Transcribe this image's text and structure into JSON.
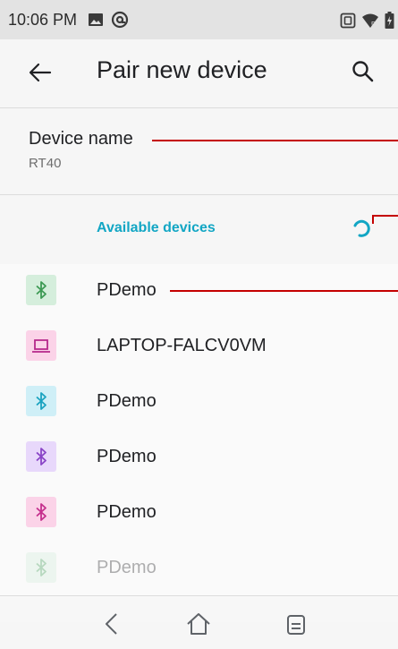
{
  "status_bar": {
    "time": "10:06 PM",
    "left_icons": [
      "image-icon",
      "at-sign-icon"
    ],
    "right_icons": [
      "nfc-icon",
      "wifi-icon",
      "battery-charging-icon"
    ]
  },
  "app_bar": {
    "back_icon": "arrow-left-icon",
    "title": "Pair new device",
    "search_icon": "search-icon"
  },
  "device_name": {
    "label": "Device name",
    "value": "RT40"
  },
  "available_devices": {
    "header": "Available devices",
    "spinner_icon": "loading-spinner-icon",
    "accent_color": "#12a6c4",
    "items": [
      {
        "name": "PDemo",
        "icon": "bluetooth-icon",
        "tile_color": "#d5eedc",
        "icon_color": "#3d9a54"
      },
      {
        "name": "LAPTOP-FALCV0VM",
        "icon": "laptop-icon",
        "tile_color": "#fbd3e8",
        "icon_color": "#b5288a"
      },
      {
        "name": "PDemo",
        "icon": "bluetooth-icon",
        "tile_color": "#cfeff7",
        "icon_color": "#1aa3c0"
      },
      {
        "name": "PDemo",
        "icon": "bluetooth-icon",
        "tile_color": "#e8d8fb",
        "icon_color": "#8a45c7"
      },
      {
        "name": "PDemo",
        "icon": "bluetooth-icon",
        "tile_color": "#fbd3e8",
        "icon_color": "#c52f8d"
      },
      {
        "name": "PDemo",
        "icon": "bluetooth-icon",
        "tile_color": "#d5eedc",
        "icon_color": "#3d9a54"
      }
    ]
  },
  "nav_bar": {
    "back_icon": "nav-back-icon",
    "home_icon": "nav-home-icon",
    "recents_icon": "nav-recents-icon"
  },
  "annotation_color": "#c40000"
}
